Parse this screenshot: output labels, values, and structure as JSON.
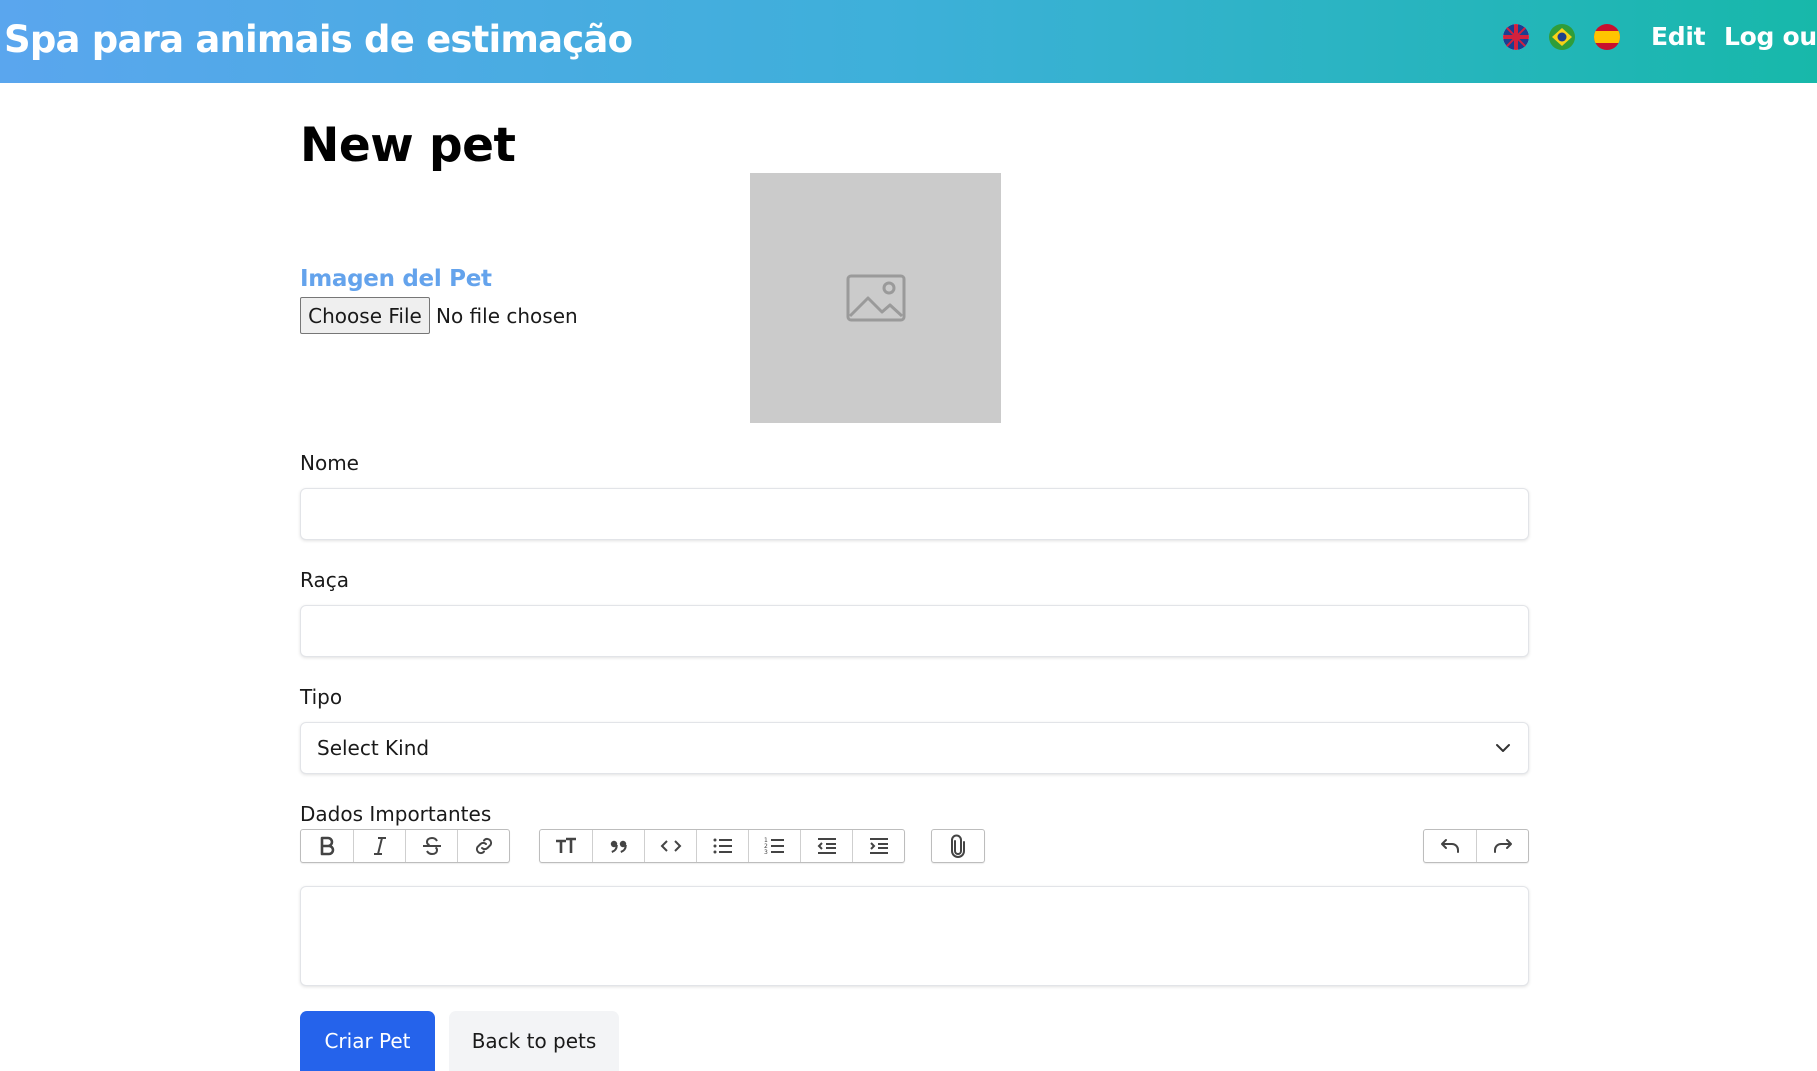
{
  "navbar": {
    "brand": "Spa para animais de estimação",
    "flags": [
      "uk-flag-icon",
      "brazil-flag-icon",
      "spain-flag-icon"
    ],
    "edit_label": "Edit",
    "logout_label": "Log out",
    "colors": {
      "gradient_start": "#5aa6ee",
      "gradient_end": "#17b8aa"
    }
  },
  "page": {
    "title": "New pet"
  },
  "image_upload": {
    "label": "Imagen del Pet",
    "button_label": "Choose File",
    "status": "No file chosen",
    "preview_icon": "image-placeholder-icon"
  },
  "fields": {
    "name_label": "Nome",
    "name_value": "",
    "breed_label": "Raça",
    "breed_value": "",
    "kind_label": "Tipo",
    "kind_selected": "Select Kind",
    "notes_label": "Dados Importantes"
  },
  "toolbar": {
    "text_tools": [
      "bold-icon",
      "italic-icon",
      "strikethrough-icon",
      "link-icon"
    ],
    "block_tools": [
      "heading-icon",
      "quote-icon",
      "code-icon",
      "bullet-list-icon",
      "numbered-list-icon",
      "decrease-indent-icon",
      "increase-indent-icon"
    ],
    "file_tools": [
      "attach-file-icon"
    ],
    "history_tools": [
      "undo-icon",
      "redo-icon"
    ]
  },
  "actions": {
    "submit_label": "Criar Pet",
    "back_label": "Back to pets",
    "colors": {
      "primary": "#2563eb",
      "secondary": "#f3f4f6"
    }
  }
}
